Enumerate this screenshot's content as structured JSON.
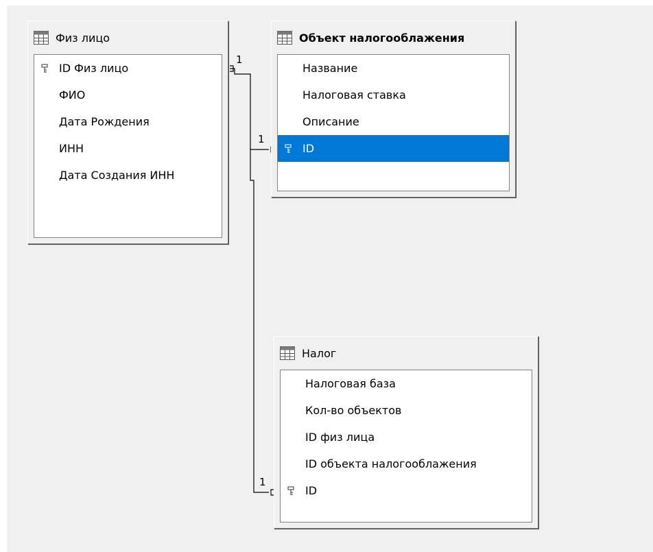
{
  "tables": {
    "fiz": {
      "title": "Физ лицо",
      "fields": [
        "ID Физ лицо",
        "ФИО",
        "Дата Рождения",
        "ИНН",
        "Дата Создания ИНН"
      ]
    },
    "obj": {
      "title": "Объект налогооблажения",
      "fields": [
        "Название",
        "Налоговая ставка",
        "Описание",
        "ID"
      ]
    },
    "nalog": {
      "title": "Налог",
      "fields": [
        "Налоговая база",
        "Кол-во объектов",
        "ID физ лица",
        "ID объекта налогооблажения",
        "ID"
      ]
    }
  },
  "relations": {
    "fiz_side": "1",
    "obj_side": "1",
    "nalog_side": "1"
  },
  "colors": {
    "selection": "#0078d7",
    "canvas": "#f0f0f0"
  }
}
